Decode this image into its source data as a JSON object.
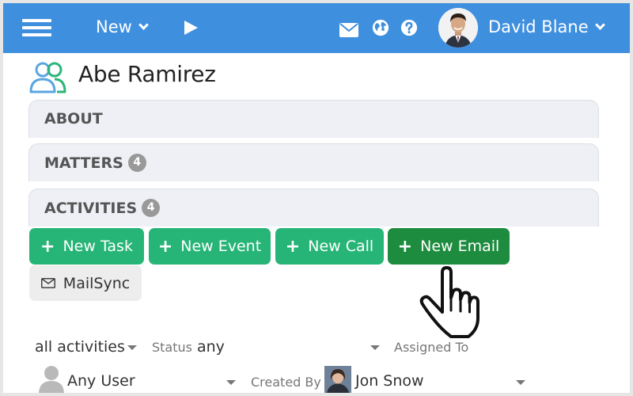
{
  "topbar": {
    "new_label": "New",
    "user_name": "David Blane",
    "icons": [
      "menu-icon",
      "play-icon",
      "mail-icon",
      "globe-icon",
      "help-icon",
      "avatar"
    ],
    "bar_color": "#3f8fdf"
  },
  "contact": {
    "name": "Abe Ramirez"
  },
  "sections": {
    "about": {
      "label": "ABOUT"
    },
    "matters": {
      "label": "MATTERS",
      "count": "4"
    },
    "activities": {
      "label": "ACTIVITIES",
      "count": "4"
    }
  },
  "actions": {
    "new_task": "New Task",
    "new_event": "New Event",
    "new_call": "New Call",
    "new_email": "New Email",
    "mailsync": "MailSync",
    "button_color": "#27b577",
    "hover_color": "#1e8c3f"
  },
  "filters": {
    "activity_type": "all activities",
    "status_label": "Status",
    "status_value": "any",
    "assigned_label": "Assigned To",
    "assigned_value": "Any User",
    "created_label": "Created By",
    "created_value": "Jon Snow"
  }
}
